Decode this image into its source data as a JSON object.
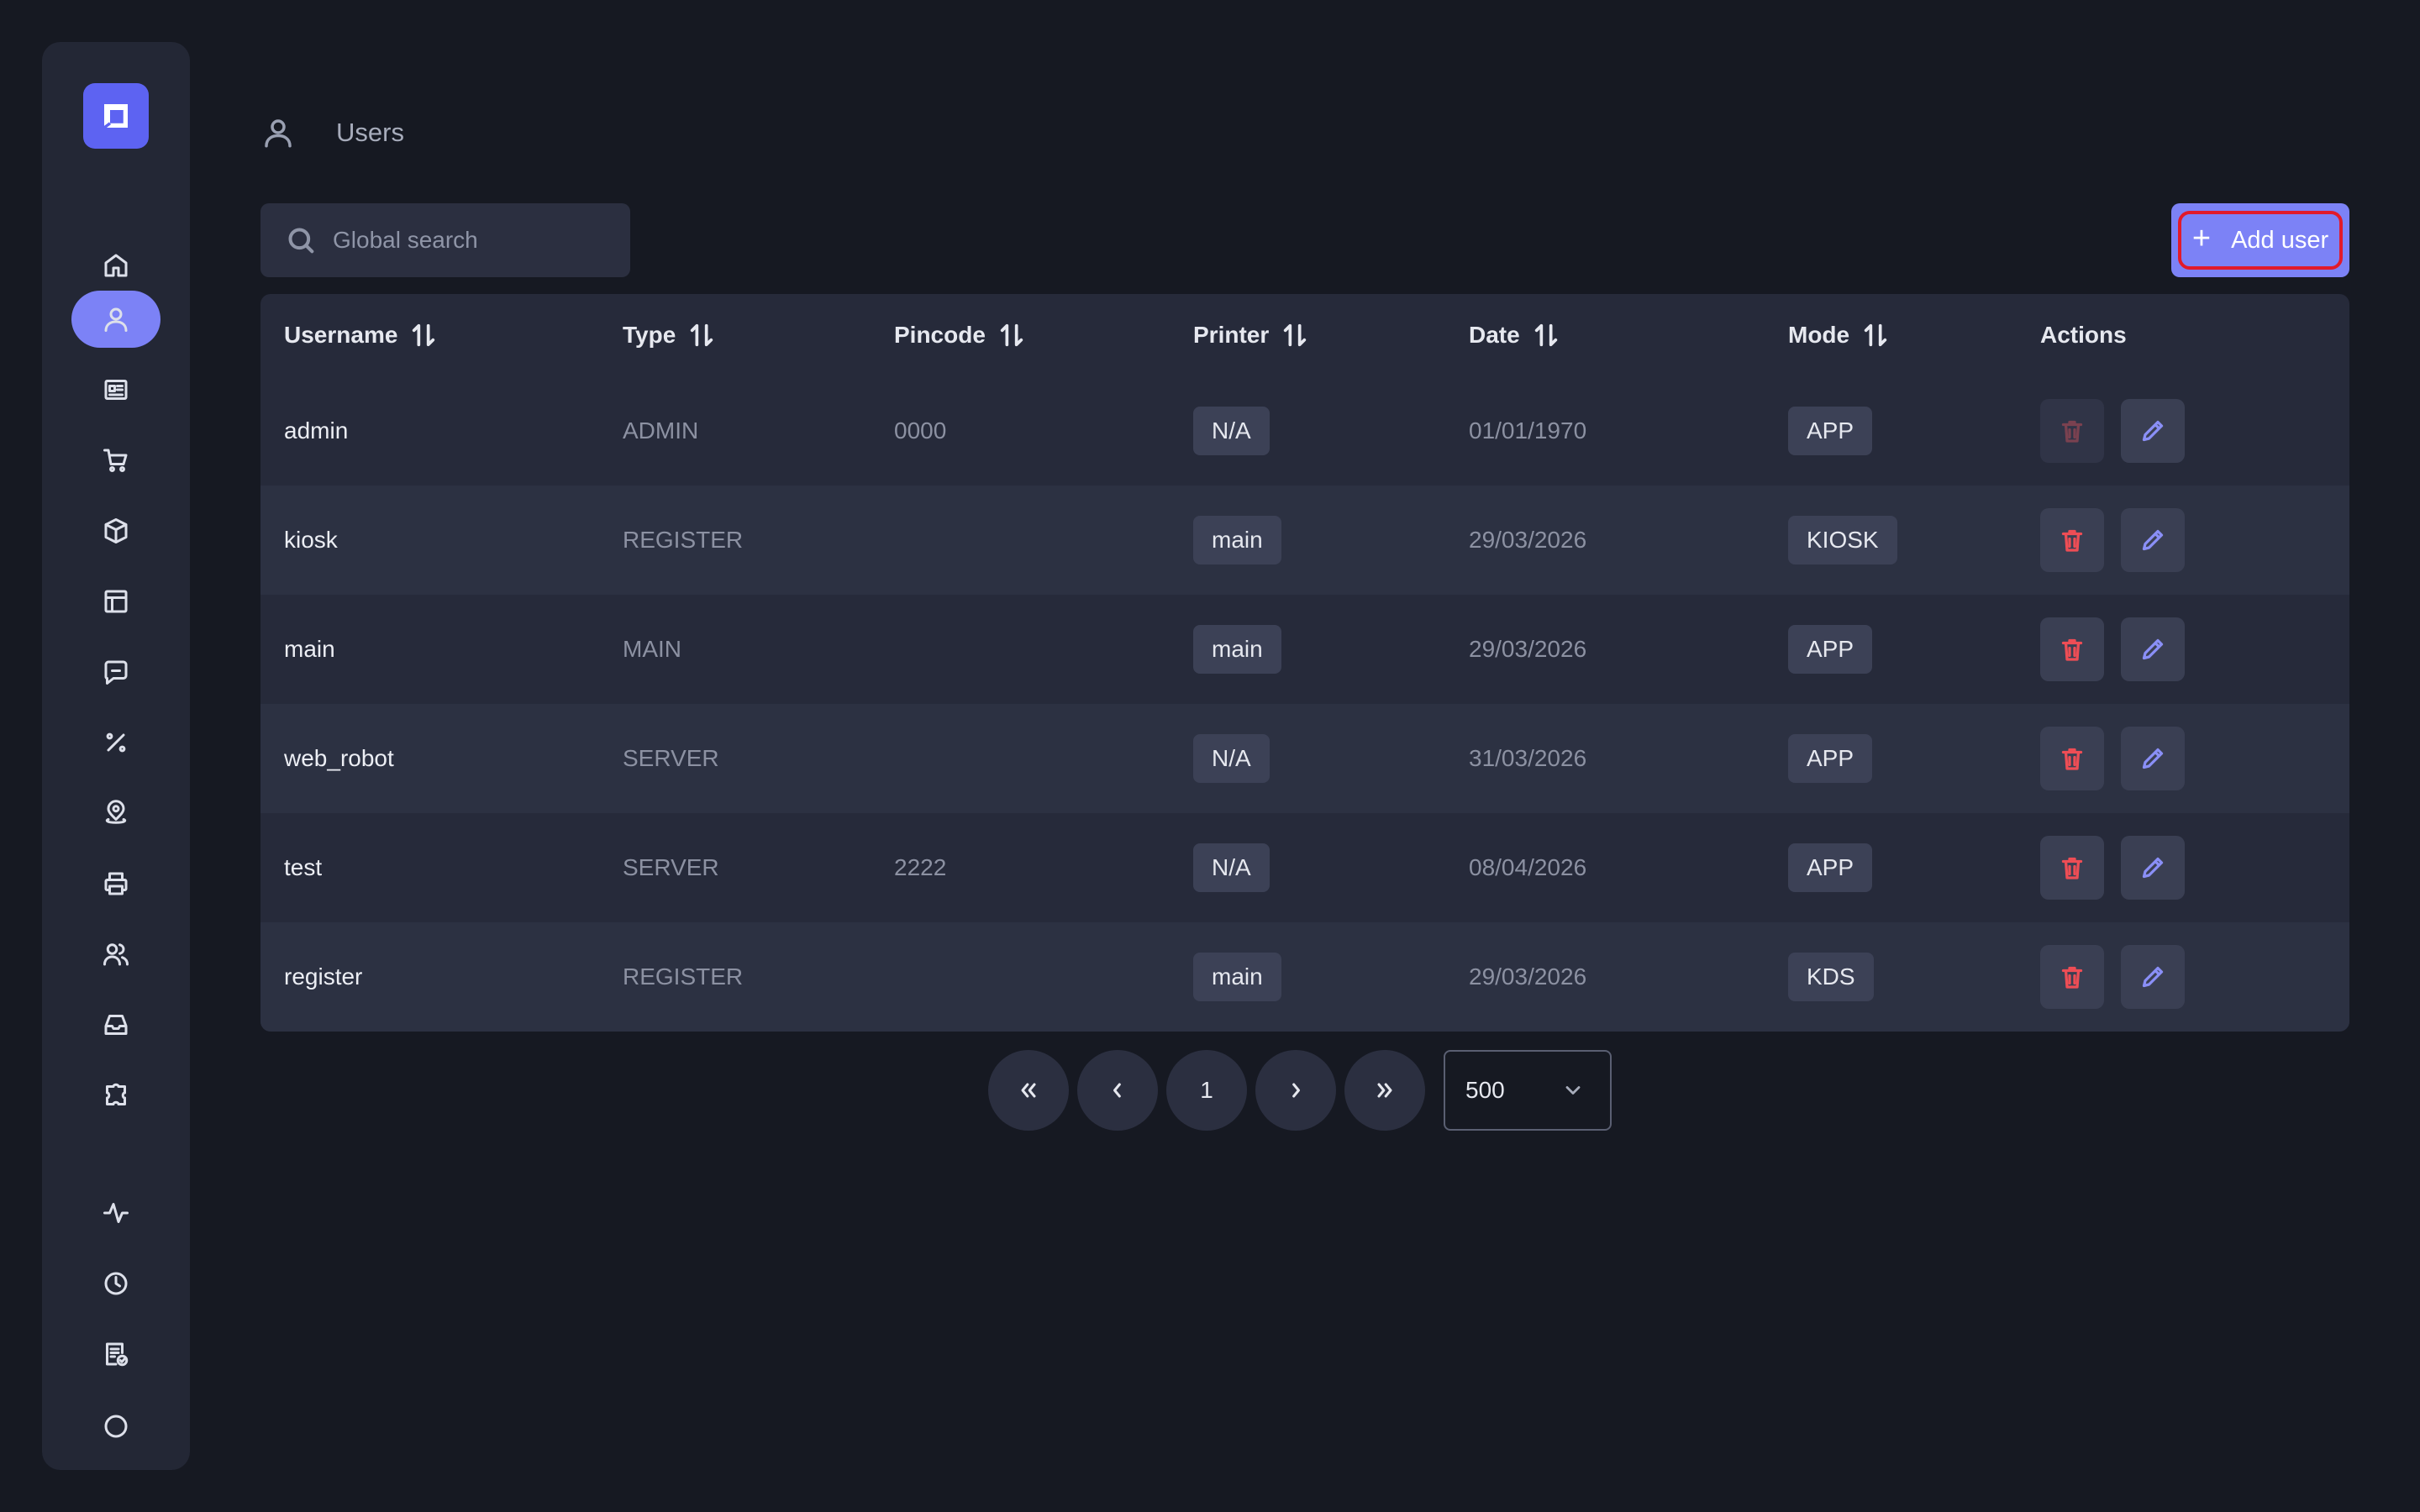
{
  "header": {
    "title": "Users",
    "icon": "user-icon"
  },
  "search": {
    "placeholder": "Global search"
  },
  "toolbar": {
    "add_label": "Add user",
    "highlight_color": "#e21a2a",
    "accent": "#7c82f6"
  },
  "sidebar": {
    "items": [
      {
        "icon": "home-icon"
      },
      {
        "icon": "user-icon",
        "active": true
      },
      {
        "icon": "newspaper-icon"
      },
      {
        "icon": "cart-icon"
      },
      {
        "icon": "box-icon"
      },
      {
        "icon": "layout-icon"
      },
      {
        "icon": "message-icon"
      },
      {
        "icon": "percent-icon"
      },
      {
        "icon": "map-pin-icon"
      },
      {
        "icon": "printer-icon"
      },
      {
        "icon": "users-icon"
      },
      {
        "icon": "inbox-icon"
      },
      {
        "icon": "puzzle-icon"
      },
      {
        "icon": "activity-icon"
      },
      {
        "icon": "clock-icon"
      },
      {
        "icon": "report-icon"
      }
    ]
  },
  "table": {
    "columns": [
      "Username",
      "Type",
      "Pincode",
      "Printer",
      "Date",
      "Mode",
      "Actions"
    ],
    "rows": [
      {
        "username": "admin",
        "type": "ADMIN",
        "pincode": "0000",
        "printer": "N/A",
        "date": "01/01/1970",
        "mode": "APP",
        "delete_disabled": true
      },
      {
        "username": "kiosk",
        "type": "REGISTER",
        "pincode": "",
        "printer": "main",
        "date": "29/03/2026",
        "mode": "KIOSK"
      },
      {
        "username": "main",
        "type": "MAIN",
        "pincode": "",
        "printer": "main",
        "date": "29/03/2026",
        "mode": "APP"
      },
      {
        "username": "web_robot",
        "type": "SERVER",
        "pincode": "",
        "printer": "N/A",
        "date": "31/03/2026",
        "mode": "APP"
      },
      {
        "username": "test",
        "type": "SERVER",
        "pincode": "2222",
        "printer": "N/A",
        "date": "08/04/2026",
        "mode": "APP"
      },
      {
        "username": "register",
        "type": "REGISTER",
        "pincode": "",
        "printer": "main",
        "date": "29/03/2026",
        "mode": "KDS"
      }
    ]
  },
  "pagination": {
    "current_page": "1",
    "page_size": "500"
  }
}
